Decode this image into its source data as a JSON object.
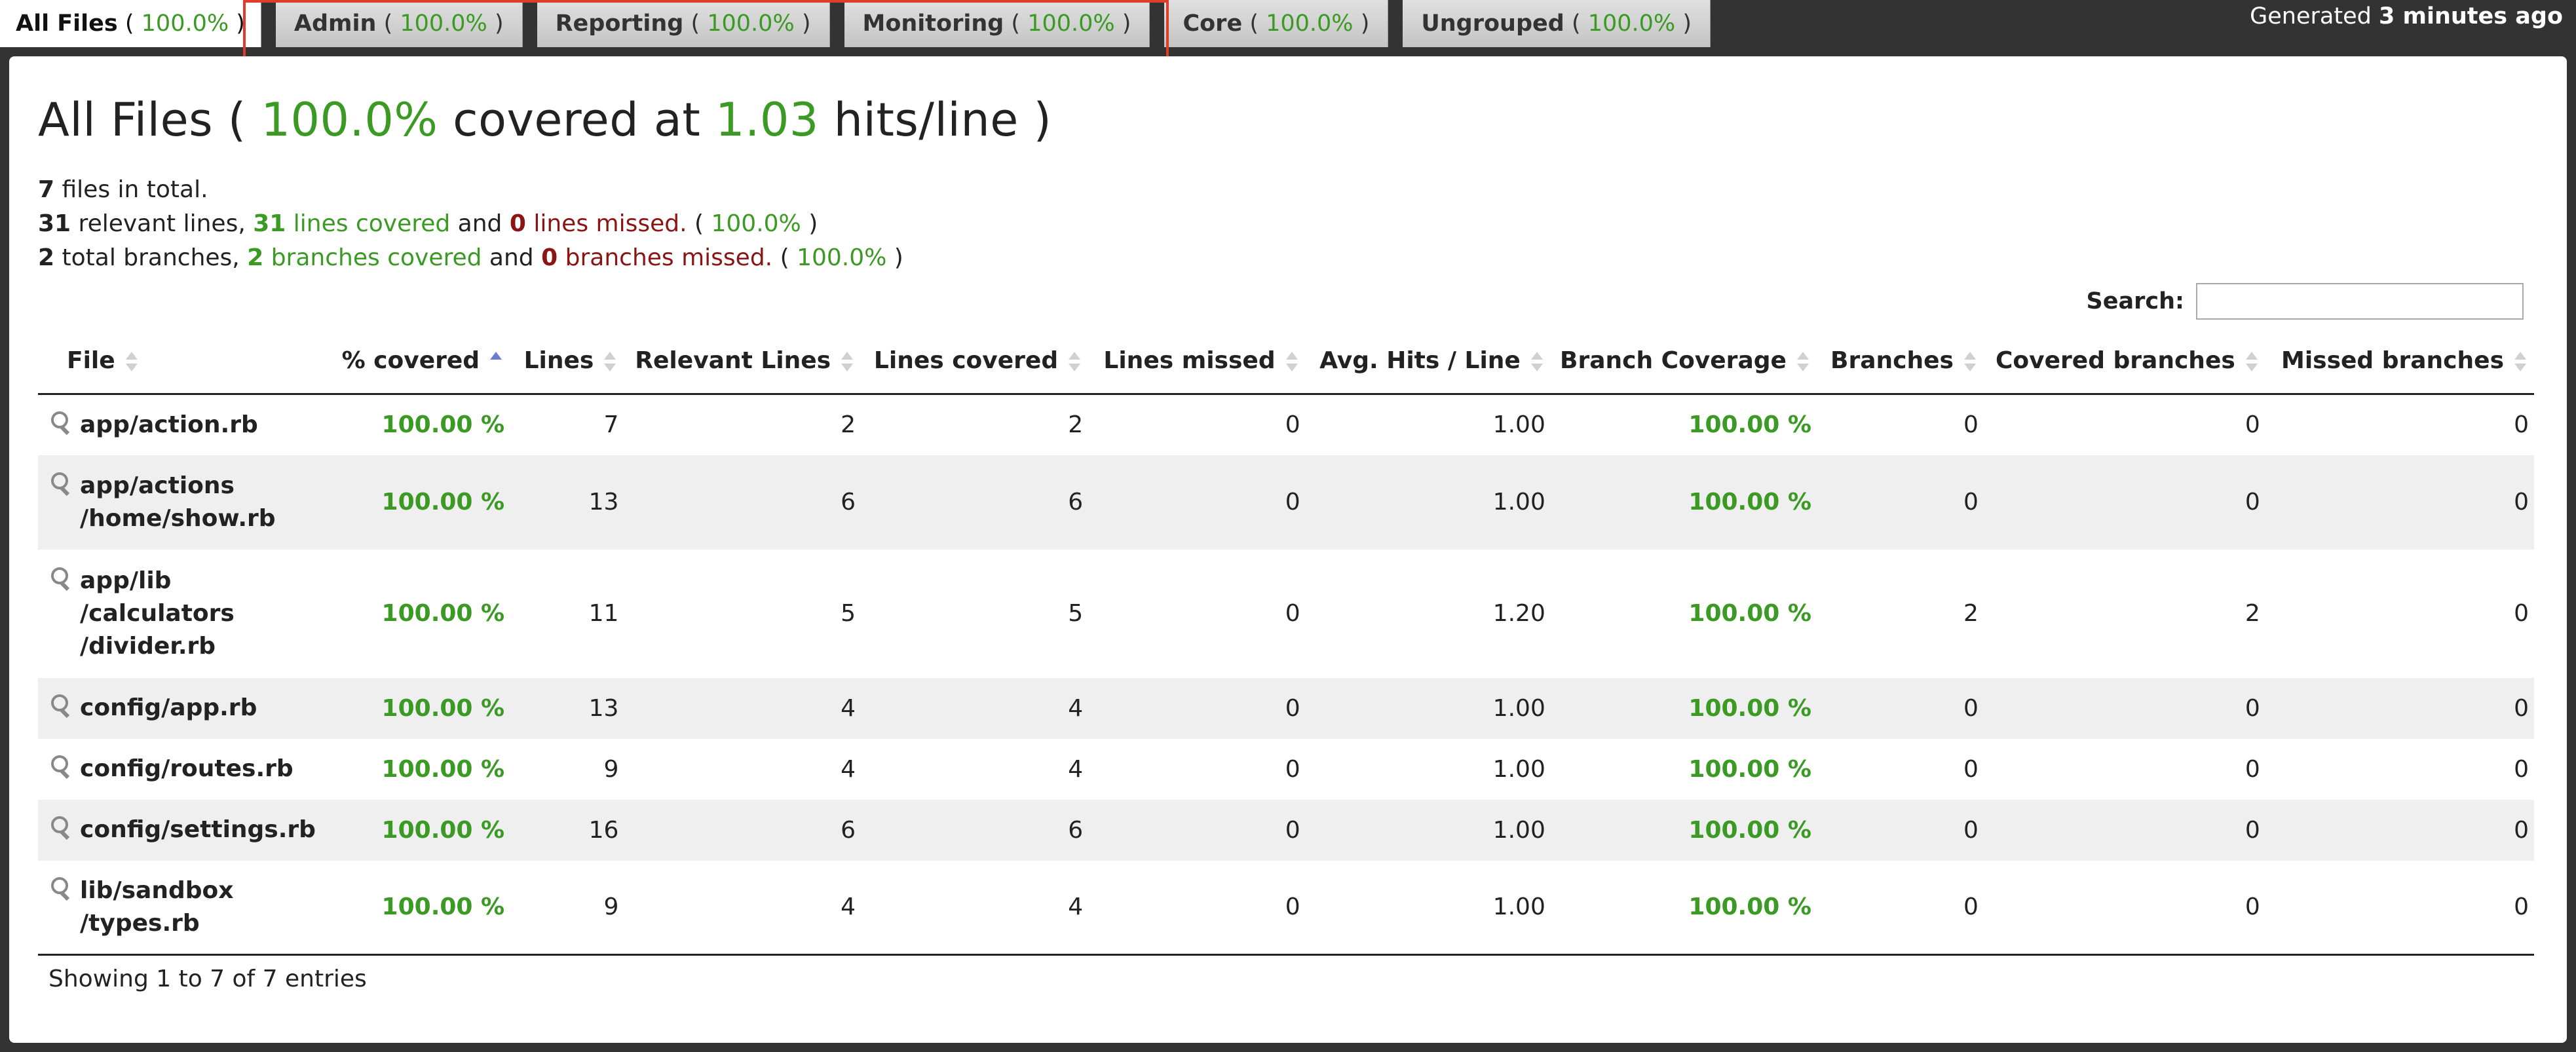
{
  "tabs": [
    {
      "label": "All Files",
      "pct": "100.0%",
      "active": true
    },
    {
      "label": "Admin",
      "pct": "100.0%"
    },
    {
      "label": "Reporting",
      "pct": "100.0%"
    },
    {
      "label": "Monitoring",
      "pct": "100.0%"
    },
    {
      "label": "Core",
      "pct": "100.0%"
    },
    {
      "label": "Ungrouped",
      "pct": "100.0%"
    }
  ],
  "generated": {
    "prefix": "Generated ",
    "value": "3 minutes ago"
  },
  "title": {
    "prefix": "All Files ( ",
    "pct": "100.0%",
    "middle": " covered at ",
    "hits": "1.03",
    "suffix": " hits/line )"
  },
  "stats": {
    "files_total": "7",
    "files_text": " files in total.",
    "relevant_lines": "31",
    "lines_covered": "31",
    "lines_missed": "0",
    "lines_pct": "100.0%",
    "total_branches": "2",
    "branches_covered": "2",
    "branches_missed": "0",
    "branches_pct": "100.0%"
  },
  "search": {
    "label": "Search:",
    "value": ""
  },
  "columns": [
    "File",
    "% covered",
    "Lines",
    "Relevant Lines",
    "Lines covered",
    "Lines missed",
    "Avg. Hits / Line",
    "Branch Coverage",
    "Branches",
    "Covered branches",
    "Missed branches"
  ],
  "rows": [
    {
      "file": [
        "app/action.rb"
      ],
      "covered": "100.00 %",
      "lines": "7",
      "relevant": "2",
      "lcovered": "2",
      "lmissed": "0",
      "avg": "1.00",
      "bcov": "100.00 %",
      "branches": "0",
      "bcovered": "0",
      "bmissed": "0"
    },
    {
      "file": [
        "app/actions",
        "/home/show.rb"
      ],
      "covered": "100.00 %",
      "lines": "13",
      "relevant": "6",
      "lcovered": "6",
      "lmissed": "0",
      "avg": "1.00",
      "bcov": "100.00 %",
      "branches": "0",
      "bcovered": "0",
      "bmissed": "0"
    },
    {
      "file": [
        "app/lib",
        "/calculators",
        "/divider.rb"
      ],
      "covered": "100.00 %",
      "lines": "11",
      "relevant": "5",
      "lcovered": "5",
      "lmissed": "0",
      "avg": "1.20",
      "bcov": "100.00 %",
      "branches": "2",
      "bcovered": "2",
      "bmissed": "0"
    },
    {
      "file": [
        "config/app.rb"
      ],
      "covered": "100.00 %",
      "lines": "13",
      "relevant": "4",
      "lcovered": "4",
      "lmissed": "0",
      "avg": "1.00",
      "bcov": "100.00 %",
      "branches": "0",
      "bcovered": "0",
      "bmissed": "0"
    },
    {
      "file": [
        "config/routes.rb"
      ],
      "covered": "100.00 %",
      "lines": "9",
      "relevant": "4",
      "lcovered": "4",
      "lmissed": "0",
      "avg": "1.00",
      "bcov": "100.00 %",
      "branches": "0",
      "bcovered": "0",
      "bmissed": "0"
    },
    {
      "file": [
        "config/settings.rb"
      ],
      "covered": "100.00 %",
      "lines": "16",
      "relevant": "6",
      "lcovered": "6",
      "lmissed": "0",
      "avg": "1.00",
      "bcov": "100.00 %",
      "branches": "0",
      "bcovered": "0",
      "bmissed": "0"
    },
    {
      "file": [
        "lib/sandbox",
        "/types.rb"
      ],
      "covered": "100.00 %",
      "lines": "9",
      "relevant": "4",
      "lcovered": "4",
      "lmissed": "0",
      "avg": "1.00",
      "bcov": "100.00 %",
      "branches": "0",
      "bcovered": "0",
      "bmissed": "0"
    }
  ],
  "footer": "Showing 1 to 7 of 7 entries"
}
